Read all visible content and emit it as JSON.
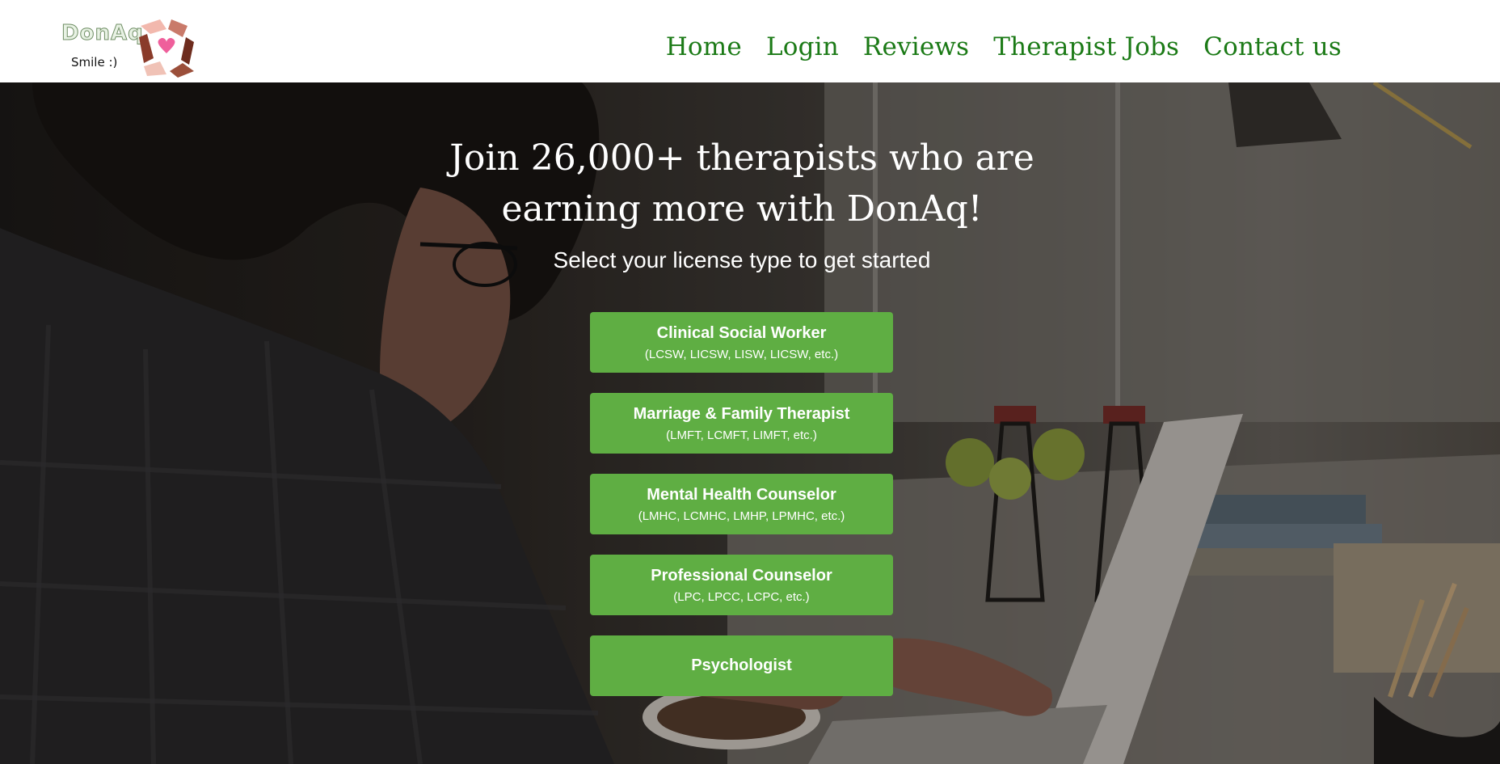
{
  "header": {
    "logo_text": "DonAq",
    "logo_tagline": "Smile :)",
    "nav": [
      "Home",
      "Login",
      "Reviews",
      "Therapist Jobs",
      "Contact us"
    ]
  },
  "hero": {
    "headline_line1": "Join 26,000+ therapists who are",
    "headline_line2": "earning more with DonAq!",
    "subhead": "Select your license type to get started",
    "buttons": [
      {
        "title": "Clinical Social Worker",
        "subtitle": "(LCSW, LICSW, LISW, LICSW, etc.)"
      },
      {
        "title": "Marriage & Family Therapist",
        "subtitle": "(LMFT, LCMFT, LIMFT, etc.)"
      },
      {
        "title": "Mental Health Counselor",
        "subtitle": "(LMHC, LCMHC, LMHP, LPMHC, etc.)"
      },
      {
        "title": "Professional Counselor",
        "subtitle": "(LPC, LPCC, LCPC, etc.)"
      },
      {
        "title": "Psychologist",
        "subtitle": ""
      }
    ]
  },
  "colors": {
    "nav_text": "#1b7a16",
    "button_bg": "#5fae43",
    "header_bg": "#ffffff"
  },
  "icons": [
    "donaq-hands-heart-logo-icon"
  ]
}
